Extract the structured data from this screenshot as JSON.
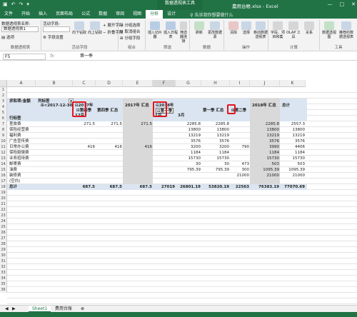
{
  "window": {
    "context_tab_title": "数据透视表工具",
    "file_name": "農用台帳.xlsx - Excel",
    "accent": "#217346",
    "qa_icons": [
      "save-icon",
      "undo-icon",
      "redo-icon",
      "customize-icon"
    ],
    "controls": [
      "minimize-icon",
      "maximize-icon",
      "close-icon"
    ]
  },
  "tabs": [
    {
      "label": "文件"
    },
    {
      "label": "开始"
    },
    {
      "label": "插入"
    },
    {
      "label": "页面布局"
    },
    {
      "label": "公式"
    },
    {
      "label": "数据"
    },
    {
      "label": "审阅"
    },
    {
      "label": "视图"
    },
    {
      "label": "分析"
    },
    {
      "label": "设计"
    }
  ],
  "tell_me": "告诉我你想要做什么",
  "ribbon": {
    "pivot_name_label": "数据透视表名称:",
    "pivot_name_value": "数据透视表1",
    "options_label": "选项",
    "group_pivot": "数据透视表",
    "active_field_label": "活动字段:",
    "field_settings": "字段设置",
    "drill_down": "向下钻取",
    "drill_up": "向上钻取",
    "expand_field": "展开字段",
    "collapse_field": "折叠字段",
    "group_active_field": "活动字段",
    "group_selection": "分组选择",
    "ungroup": "取消组合",
    "group_field": "分组字段",
    "group_group": "组合",
    "insert_slicer": "插入切片器",
    "insert_timeline": "插入日程表",
    "filter_connections": "筛选器连接",
    "group_filter": "筛选",
    "refresh": "刷新",
    "change_source": "更改数据源",
    "group_data": "数据",
    "clear": "清除",
    "select": "选择",
    "move_pivot": "移动数据透视表",
    "group_actions": "操作",
    "fields_items": "字段、项目和集",
    "olap_tools": "OLAP 工具",
    "relationships": "关系",
    "group_calc": "计算",
    "pivot_chart": "数据透视图",
    "recommended_pivot": "推荐的数据透视表",
    "group_tools": "工具"
  },
  "formula_bar": {
    "name_box": "F5",
    "fx": "fx",
    "value": "第一季"
  },
  "columns": [
    "A",
    "B",
    "C",
    "D",
    "E",
    "F",
    "G",
    "H",
    "I",
    "J",
    "K"
  ],
  "rows": [
    "1",
    "2",
    "3",
    "4",
    "5",
    "6",
    "7",
    "8",
    "9",
    "10",
    "11",
    "12",
    "13",
    "14",
    "15",
    "16",
    "17",
    "18",
    "19",
    "20",
    "21",
    "22",
    "23",
    "24",
    "25",
    "26",
    "27",
    "28",
    "29",
    "30",
    "31",
    "32",
    "33",
    "34",
    "35",
    "36"
  ],
  "pivot": {
    "sum_label": "求和项:金额",
    "col_label": "列标签",
    "filter_arrow": "▼",
    "date_filter": "⊞<2017-12-30",
    "y2017": "⊟2017年",
    "y2017_q4": "⊟第四季",
    "m12": "12月",
    "q4_total": "第四季 汇总",
    "total_2017": "2017年 汇总",
    "y2018": "⊟2018年",
    "q1_2018": "⊟第一季",
    "m1": "1月",
    "m3": "3月",
    "q1_total": "第一季 汇总",
    "q2_2018": "⊞第二季",
    "total_2018": "2018年 汇总",
    "grand": "总计",
    "row_label": "行标签",
    "row_names": [
      "差旅费",
      "保险经营费",
      "福利费",
      "广告宣传费",
      "日常办公费",
      "保险赔偿费",
      "业务招待费",
      "邮寄费",
      "油费",
      "装修费",
      "(空白)",
      "总计"
    ],
    "values": {
      "c": [
        "271.5",
        "",
        "",
        "",
        "416",
        "",
        "",
        "",
        "",
        "",
        "",
        "687.5"
      ],
      "d": [
        "271.5",
        "",
        "",
        "",
        "416",
        "",
        "",
        "",
        "",
        "",
        "",
        "687.5"
      ],
      "e": [
        "271.5",
        "",
        "",
        "",
        "416",
        "",
        "",
        "",
        "",
        "",
        "",
        "687.5"
      ],
      "f": [
        "",
        "",
        "",
        "",
        "",
        "",
        "",
        "",
        "",
        "",
        "",
        "27019"
      ],
      "g": [
        "2285.8",
        "13800",
        "13219",
        "3576",
        "3200",
        "1184",
        "15730",
        "30",
        "795.39",
        "",
        "",
        "26801.19"
      ],
      "h": [
        "2285.8",
        "13800",
        "13219",
        "3576",
        "3200",
        "1184",
        "15730",
        "30",
        "795.39",
        "",
        "",
        "53820.19"
      ],
      "i": [
        "",
        "",
        "",
        "",
        "790",
        "",
        "",
        "473",
        "300",
        "21000",
        "",
        "22563"
      ],
      "j": [
        "2285.8",
        "13800",
        "13219",
        "3576",
        "3990",
        "1184",
        "15730",
        "503",
        "1095.39",
        "21000",
        "",
        "76383.19"
      ],
      "k": [
        "2557.3",
        "13800",
        "13219",
        "3576",
        "4406",
        "1184",
        "15730",
        "503",
        "1095.39",
        "21000",
        "",
        "77070.69"
      ]
    }
  },
  "sheets": [
    {
      "label": "Sheet1"
    },
    {
      "label": "费用台账"
    }
  ]
}
